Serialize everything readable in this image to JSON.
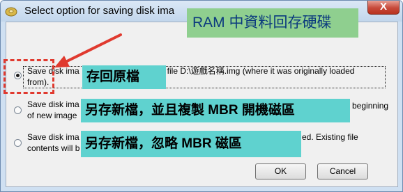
{
  "window": {
    "title": "Select option for saving disk ima",
    "close_label": "X"
  },
  "options": [
    {
      "line1_start": "Save disk ima",
      "line1_end": "ge file D:\\遊戲名稱.img (where it was originally loaded",
      "line2": "from).",
      "selected": true
    },
    {
      "line1_start": "Save disk ima",
      "line1_end": "beginning",
      "line2": "of new image",
      "selected": false
    },
    {
      "line1_start": "Save disk ima",
      "line1_end": "ed. Existing file",
      "line2": "contents will b",
      "selected": false
    }
  ],
  "buttons": {
    "ok": "OK",
    "cancel": "Cancel"
  },
  "annotations": {
    "header": "RAM 中資料回存硬碟",
    "option1": "存回原檔",
    "option2": "另存新檔，並且複製 MBR 開機磁區",
    "option3": "另存新檔，忽略 MBR 磁區"
  },
  "colors": {
    "annotation_bg": "#5fd2cf",
    "header_bg": "#8fcf8f",
    "header_text": "#0b3a7e",
    "highlight_red": "#e03a2f"
  }
}
